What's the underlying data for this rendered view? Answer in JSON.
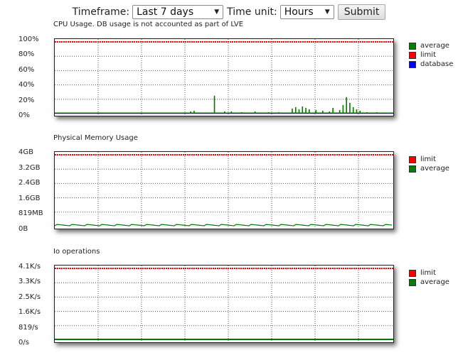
{
  "controls": {
    "timeframe_label": "Timeframe:",
    "timeframe_value": "Last 7 days",
    "timeunit_label": "Time unit:",
    "timeunit_value": "Hours",
    "submit_label": "Submit"
  },
  "colors": {
    "average": "#007700",
    "limit": "#ff0000",
    "database": "#0000ff"
  },
  "charts": [
    {
      "title": "CPU Usage. DB usage is not accounted as part of LVE",
      "yticks": [
        "100%",
        "80%",
        "60%",
        "40%",
        "20%",
        "0%"
      ],
      "legend": [
        {
          "label": "average",
          "color": "#008000"
        },
        {
          "label": "limit",
          "color": "#ff0000"
        },
        {
          "label": "database",
          "color": "#0000ff"
        }
      ]
    },
    {
      "title": "Physical Memory Usage",
      "yticks": [
        "4GB",
        "3.2GB",
        "2.4GB",
        "1.6GB",
        "819MB",
        "0B"
      ],
      "legend": [
        {
          "label": "limit",
          "color": "#ff0000"
        },
        {
          "label": "average",
          "color": "#008000"
        }
      ]
    },
    {
      "title": "Io operations",
      "yticks": [
        "4.1K/s",
        "3.3K/s",
        "2.5K/s",
        "1.6K/s",
        "819/s",
        "0/s"
      ],
      "legend": [
        {
          "label": "limit",
          "color": "#ff0000"
        },
        {
          "label": "average",
          "color": "#008000"
        }
      ]
    }
  ],
  "chart_data": [
    {
      "type": "area",
      "ylim": [
        0,
        100
      ],
      "grid": true,
      "legend": "right",
      "series": [
        {
          "name": "limit",
          "values": [
            100,
            100
          ]
        },
        {
          "name": "database",
          "values": [
            0,
            0
          ]
        },
        {
          "name": "average",
          "spikes": [
            [
              0.4,
              3
            ],
            [
              0.41,
              4
            ],
            [
              0.47,
              25
            ],
            [
              0.5,
              3
            ],
            [
              0.52,
              3
            ],
            [
              0.55,
              2
            ],
            [
              0.59,
              3
            ],
            [
              0.63,
              2
            ],
            [
              0.66,
              2
            ],
            [
              0.7,
              7
            ],
            [
              0.71,
              9
            ],
            [
              0.72,
              6
            ],
            [
              0.73,
              10
            ],
            [
              0.74,
              8
            ],
            [
              0.75,
              6
            ],
            [
              0.77,
              5
            ],
            [
              0.79,
              4
            ],
            [
              0.81,
              3
            ],
            [
              0.82,
              8
            ],
            [
              0.84,
              5
            ],
            [
              0.85,
              12
            ],
            [
              0.86,
              23
            ],
            [
              0.87,
              15
            ],
            [
              0.88,
              9
            ],
            [
              0.89,
              6
            ],
            [
              0.9,
              4
            ],
            [
              0.92,
              2
            ],
            [
              0.95,
              2
            ],
            [
              0.98,
              1
            ]
          ]
        }
      ]
    },
    {
      "type": "area",
      "ylim": [
        0,
        4
      ],
      "grid": true,
      "legend": "right",
      "series": [
        {
          "name": "limit",
          "values": [
            4,
            4
          ]
        },
        {
          "name": "average",
          "baseline": 0.04
        }
      ]
    },
    {
      "type": "line",
      "ylim": [
        0,
        4.1
      ],
      "grid": true,
      "legend": "right",
      "series": [
        {
          "name": "limit",
          "values": [
            4.1,
            4.1
          ]
        },
        {
          "name": "average",
          "values": [
            0,
            0
          ]
        }
      ]
    }
  ]
}
